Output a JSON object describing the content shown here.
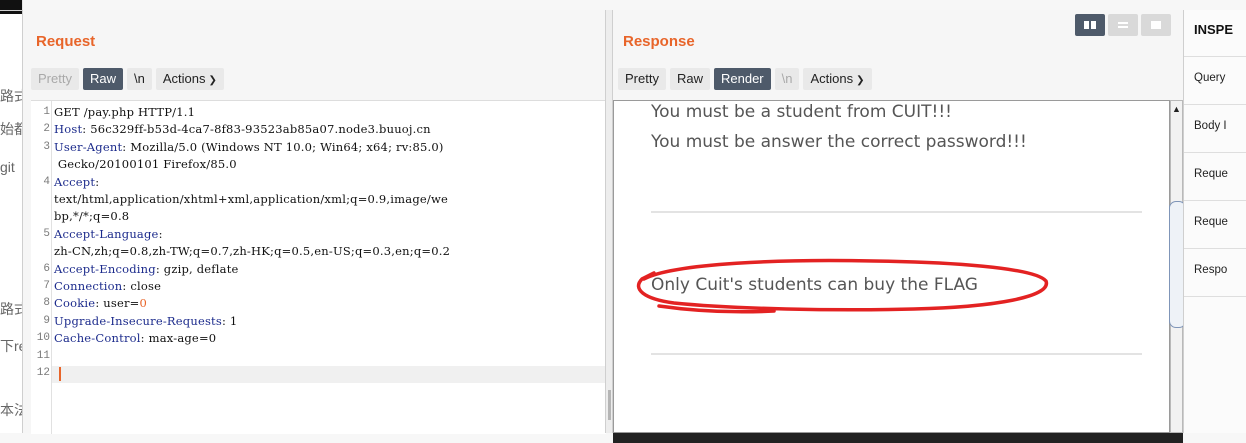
{
  "background_fragments": [
    "路式",
    "始都",
    "git",
    "路式",
    "下re",
    "本法"
  ],
  "request": {
    "title": "Request",
    "buttons": {
      "pretty": "Pretty",
      "raw": "Raw",
      "newline": "\\n",
      "actions": "Actions"
    },
    "lines": [
      {
        "n": "1",
        "name": "",
        "value": "GET /pay.php HTTP/1.1"
      },
      {
        "n": "2",
        "name": "Host",
        "value": ": 56c329ff-b53d-4ca7-8f83-93523ab85a07.node3.buuoj.cn"
      },
      {
        "n": "3",
        "name": "User-Agent",
        "value": ": Mozilla/5.0 (Windows NT 10.0; Win64; x64; rv:85.0)"
      },
      {
        "n": "",
        "name": "",
        "value": " Gecko/20100101 Firefox/85.0"
      },
      {
        "n": "4",
        "name": "Accept",
        "value": ":"
      },
      {
        "n": "",
        "name": "",
        "value": "text/html,application/xhtml+xml,application/xml;q=0.9,image/we"
      },
      {
        "n": "",
        "name": "",
        "value": "bp,*/*;q=0.8"
      },
      {
        "n": "5",
        "name": "Accept-Language",
        "value": ":"
      },
      {
        "n": "",
        "name": "",
        "value": "zh-CN,zh;q=0.8,zh-TW;q=0.7,zh-HK;q=0.5,en-US;q=0.3,en;q=0.2"
      },
      {
        "n": "6",
        "name": "Accept-Encoding",
        "value": ": gzip, deflate"
      },
      {
        "n": "7",
        "name": "Connection",
        "value": ": close"
      },
      {
        "n": "8",
        "name": "Cookie",
        "value": ": user=0"
      },
      {
        "n": "9",
        "name": "Upgrade-Insecure-Requests",
        "value": ": 1"
      },
      {
        "n": "10",
        "name": "Cache-Control",
        "value": ": max-age=0"
      },
      {
        "n": "11",
        "name": "",
        "value": ""
      },
      {
        "n": "12",
        "name": "",
        "value": ""
      }
    ]
  },
  "response": {
    "title": "Response",
    "buttons": {
      "pretty": "Pretty",
      "raw": "Raw",
      "render": "Render",
      "newline": "\\n",
      "actions": "Actions"
    },
    "render_lines": [
      "You must be a student from CUIT!!!",
      "You must be answer the correct password!!!",
      "Only Cuit's students can buy the FLAG"
    ]
  },
  "inspector": {
    "title": "INSPE",
    "rows": [
      "Query",
      "Body I",
      "Reque",
      "Reque",
      "Respo"
    ]
  },
  "colors": {
    "accent": "#e8652a",
    "selected": "#4e5a6a",
    "annotation": "#e32222",
    "header_name": "#1c2b8c"
  },
  "icons": {
    "actions_dropdown": "chevron-down-icon",
    "view_split": "split-view-icon",
    "view_horizontal": "horizontal-view-icon",
    "view_single": "single-view-icon"
  }
}
